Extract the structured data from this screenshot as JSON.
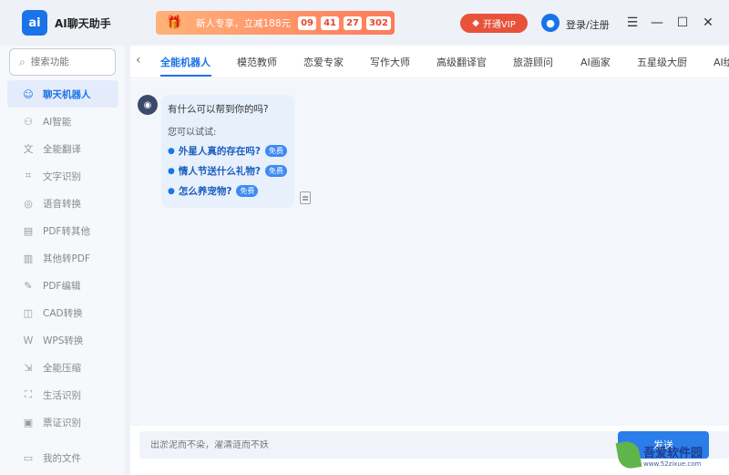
{
  "app": {
    "logo_text": "ai",
    "title": "AI聊天助手"
  },
  "promo": {
    "text": "新人专享，立减188元",
    "timer": [
      "09",
      "41",
      "27",
      "302"
    ]
  },
  "header": {
    "vip_label": "开通VIP",
    "login_label": "登录/注册",
    "icons": [
      "menu-icon",
      "minimize-icon",
      "maximize-icon",
      "close-icon"
    ]
  },
  "sidebar": {
    "search_placeholder": "搜索功能",
    "items": [
      {
        "label": "聊天机器人",
        "icon": "robot-icon",
        "active": true
      },
      {
        "label": "AI智能",
        "icon": "ai-icon"
      },
      {
        "label": "全能翻译",
        "icon": "translate-icon"
      },
      {
        "label": "文字识别",
        "icon": "scan-text-icon"
      },
      {
        "label": "语音转换",
        "icon": "voice-icon"
      },
      {
        "label": "PDF转其他",
        "icon": "pdf-icon"
      },
      {
        "label": "其他转PDF",
        "icon": "to-pdf-icon"
      },
      {
        "label": "PDF编辑",
        "icon": "pdf-edit-icon"
      },
      {
        "label": "CAD转换",
        "icon": "cad-icon"
      },
      {
        "label": "WPS转换",
        "icon": "wps-icon"
      },
      {
        "label": "全能压缩",
        "icon": "compress-icon"
      },
      {
        "label": "生活识别",
        "icon": "life-scan-icon"
      },
      {
        "label": "票证识别",
        "icon": "ticket-icon"
      }
    ],
    "bottom_item": {
      "label": "我的文件",
      "icon": "folder-icon"
    }
  },
  "tabs": [
    "全能机器人",
    "模范教师",
    "恋爱专家",
    "写作大师",
    "高级翻译官",
    "旅游顾问",
    "AI画家",
    "五星级大厨",
    "AI绘"
  ],
  "chat": {
    "question": "有什么可以帮到你的吗?",
    "hint": "您可以试试:",
    "suggestions": [
      {
        "text": "外星人真的存在吗?",
        "badge": "免费"
      },
      {
        "text": "情人节送什么礼物?",
        "badge": "免费"
      },
      {
        "text": "怎么养宠物?",
        "badge": "免费"
      }
    ]
  },
  "composer": {
    "placeholder": "出淤泥而不染，濯清涟而不妖",
    "send_label": "发送"
  },
  "watermark": {
    "name": "吾爱软件园",
    "url": "www.52zixue.com"
  },
  "colors": {
    "accent": "#1a73e8",
    "promo": "#ff7a59",
    "vip": "#e8523a"
  }
}
